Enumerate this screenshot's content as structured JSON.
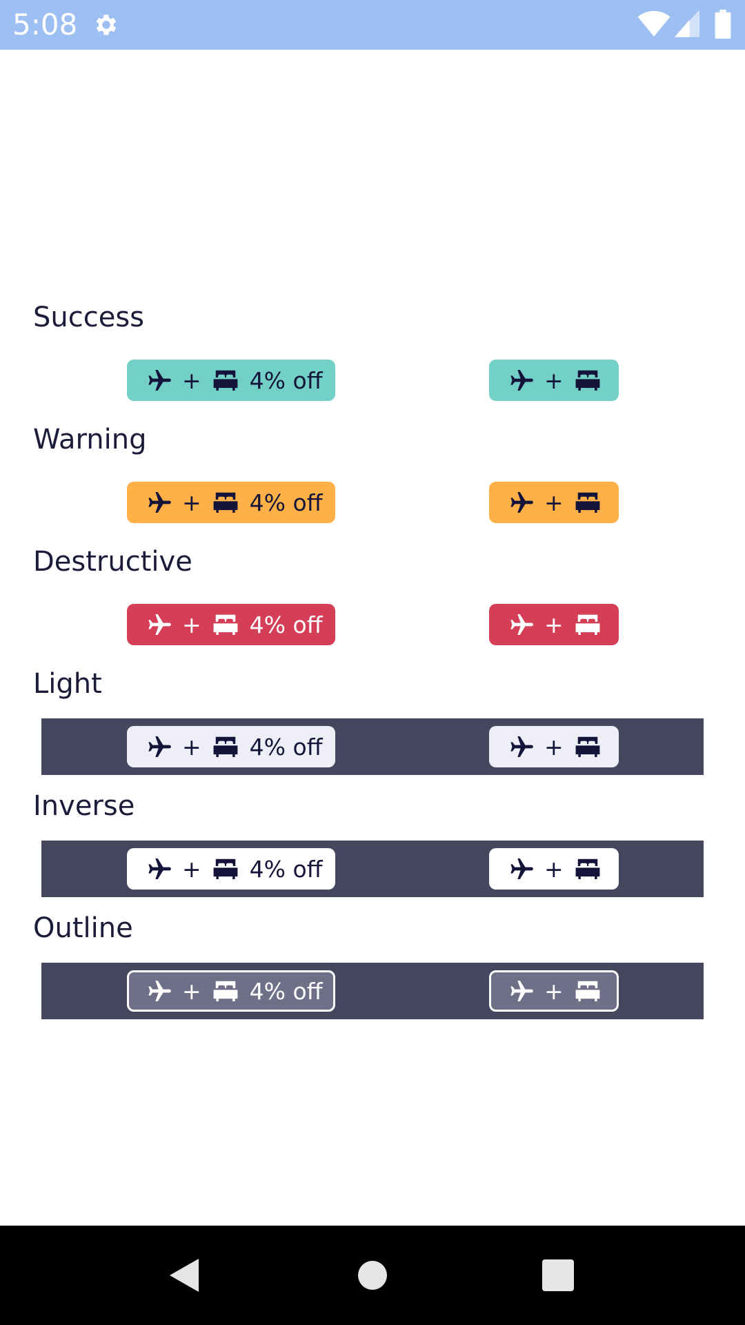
{
  "status_bar": {
    "time": "5:08",
    "icons": [
      "gear-icon",
      "wifi-icon",
      "cellular-signal-icon",
      "battery-icon"
    ]
  },
  "badge_parts": {
    "plus": "+",
    "discount": "4% off",
    "icons": [
      "airplane-icon",
      "bed-icon"
    ]
  },
  "sections": [
    {
      "label": "Success",
      "variant": "success",
      "background": "#73d0c7",
      "text_color": "#14143a"
    },
    {
      "label": "Warning",
      "variant": "warning",
      "background": "#ffb148",
      "text_color": "#14143a"
    },
    {
      "label": "Destructive",
      "variant": "destructive",
      "background": "#d43f57",
      "text_color": "#ffffff"
    },
    {
      "label": "Light",
      "variant": "light",
      "background": "#eeeff6",
      "text_color": "#14143a",
      "on_dark": true
    },
    {
      "label": "Inverse",
      "variant": "inverse",
      "background": "#ffffff",
      "text_color": "#14143a",
      "on_dark": true
    },
    {
      "label": "Outline",
      "variant": "outline",
      "background": "#6f7087",
      "text_color": "#ffffff",
      "on_dark": true
    }
  ],
  "colors": {
    "status_bar": "#9dbff1",
    "dark_band": "#45475f",
    "text": "#1b1b3a",
    "nav_bar": "#000000"
  },
  "nav_bar": {
    "icons": [
      "back-icon",
      "home-icon",
      "recents-icon"
    ]
  }
}
